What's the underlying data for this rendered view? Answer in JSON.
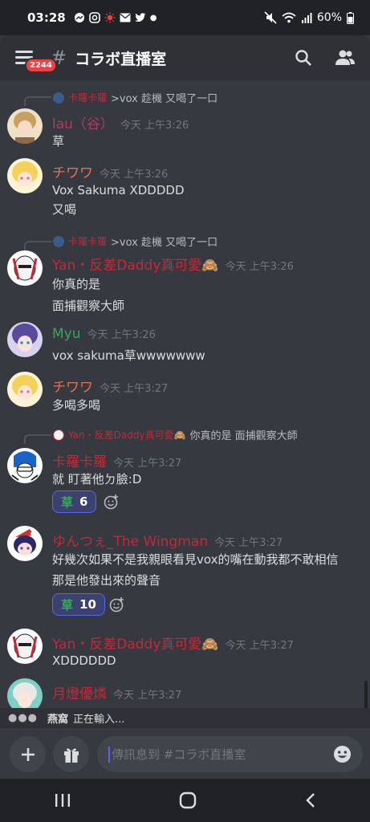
{
  "status_bar": {
    "time": "03:28",
    "battery": "60%",
    "icons": [
      "messenger-icon",
      "instagram-icon",
      "sun-icon",
      "mail-icon",
      "twitter-icon",
      "dot-icon",
      "mute-icon",
      "wifi-icon",
      "signal-icon",
      "battery-icon"
    ]
  },
  "header": {
    "hash": "#",
    "channel_name": "コラボ直播室",
    "unread_badge": "2244"
  },
  "messages": [
    {
      "reply": {
        "name": "卡羅卡羅",
        "text": ">vox 趁機 又喝了一口"
      },
      "author": "lau（谷）",
      "author_color": "#b03a5b",
      "time": "今天 上午3:26",
      "lines": [
        "草"
      ]
    },
    {
      "author": "チワワ",
      "author_color": "#e07050",
      "time": "今天 上午3:26",
      "lines": [
        "Vox Sakuma XDDDDD",
        "又喝"
      ]
    },
    {
      "reply": {
        "name": "卡羅卡羅",
        "text": ">vox 趁機 又喝了一口"
      },
      "author": "Yan・反差Daddy真可愛",
      "author_emoji": "🙈",
      "author_color": "#c4293a",
      "time": "今天 上午3:26",
      "lines": [
        "你真的是",
        "面捕觀察大師"
      ]
    },
    {
      "author": "Myu",
      "author_color": "#3ba55c",
      "time": "今天 上午3:26",
      "lines": [
        "vox sakuma草wwwwwww"
      ]
    },
    {
      "author": "チワワ",
      "author_color": "#e07050",
      "time": "今天 上午3:27",
      "lines": [
        "多喝多喝"
      ]
    },
    {
      "reply": {
        "name": "Yan・反差Daddy真可愛",
        "name_emoji": "🙈",
        "text": "你真的是 面捕觀察大師"
      },
      "author": "卡羅卡羅",
      "author_color": "#c4293a",
      "time": "今天 上午3:27",
      "lines": [
        "就 盯著他ㄉ臉:D"
      ],
      "reaction": {
        "emoji": "草",
        "count": "6"
      }
    },
    {
      "author": "ゆんつぇ_The Wingman",
      "author_color": "#c4293a",
      "time": "今天 上午3:27",
      "lines": [
        "好幾次如果不是我親眼看見vox的嘴在動我都不敢相信",
        "那是他發出來的聲音"
      ],
      "reaction": {
        "emoji": "草",
        "count": "10"
      }
    },
    {
      "author": "Yan・反差Daddy真可愛",
      "author_emoji": "🙈",
      "author_color": "#c4293a",
      "time": "今天 上午3:27",
      "lines": [
        "XDDDDDD"
      ]
    },
    {
      "author": "月燈優燐",
      "author_color": "#c4293a",
      "time": "今天 上午3:27",
      "lines": [
        ""
      ]
    }
  ],
  "typing": {
    "user": "燕窩",
    "text": "正在輸入..."
  },
  "composer": {
    "placeholder": "傳訊息到 #コラボ直播室"
  },
  "nav": {
    "recents": "recents-icon",
    "home": "home-icon",
    "back": "back-icon"
  }
}
